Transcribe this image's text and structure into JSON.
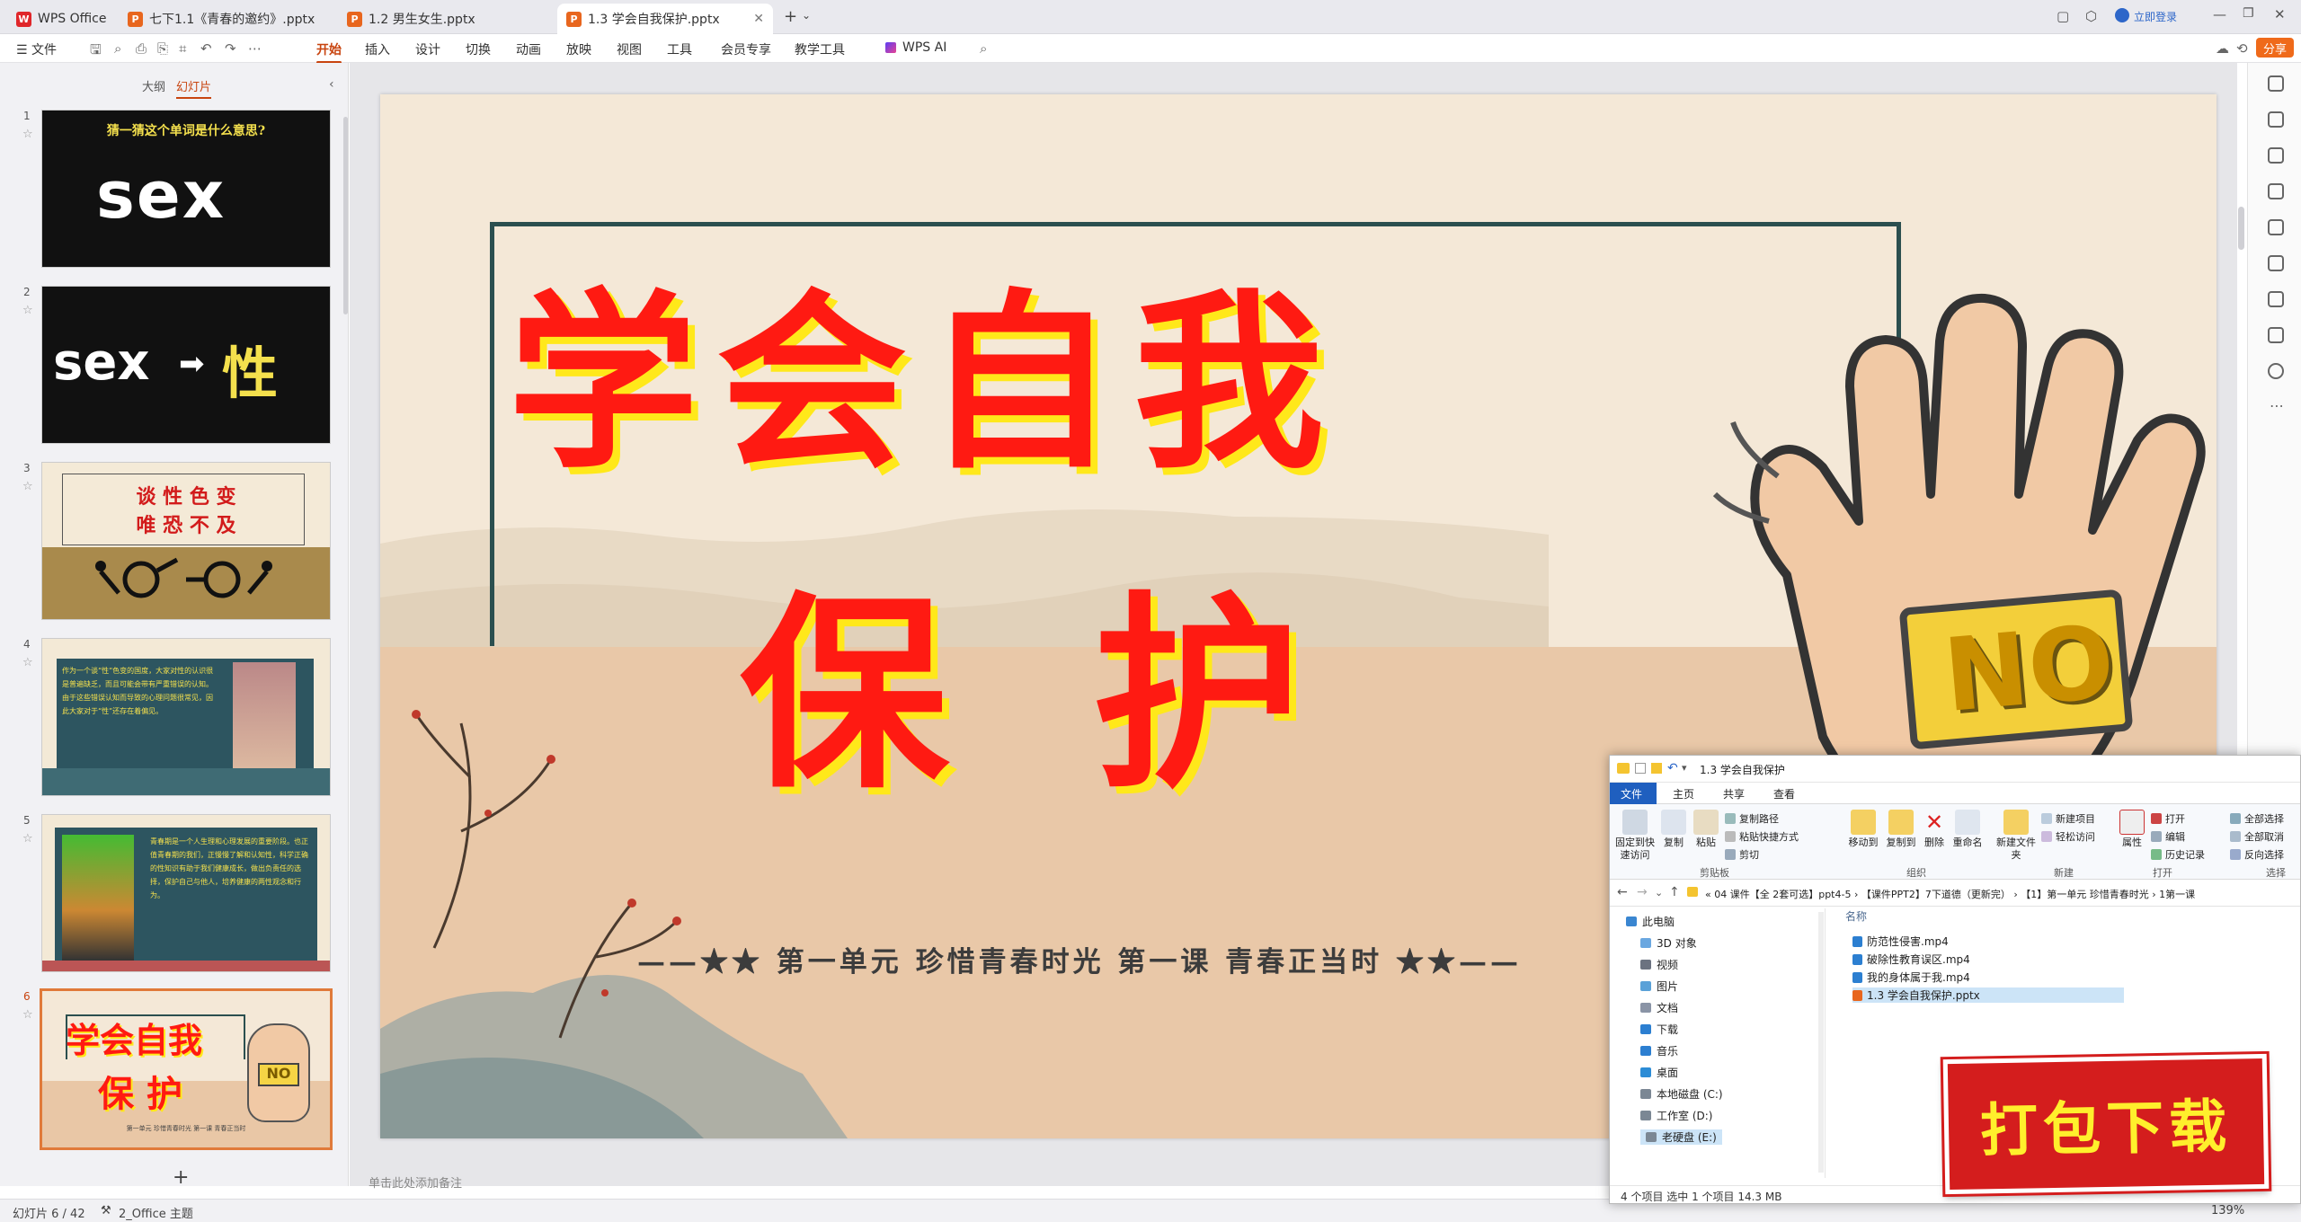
{
  "tabs": [
    {
      "label": "WPS Office",
      "icon": "wps-logo-icon"
    },
    {
      "label": "七下1.1《青春的邀约》.pptx",
      "icon": "ppt-icon"
    },
    {
      "label": "1.2 男生女生.pptx",
      "icon": "ppt-icon"
    },
    {
      "label": "1.3 学会自我保护.pptx",
      "icon": "ppt-icon"
    }
  ],
  "titlebar": {
    "login": "立即登录"
  },
  "menu": {
    "file": "☰ 文件",
    "items": [
      "开始",
      "插入",
      "设计",
      "切换",
      "动画",
      "放映",
      "视图",
      "工具",
      "会员专享",
      "教学工具"
    ],
    "ai": "WPS AI",
    "share": "分享"
  },
  "leftpanel": {
    "outline_tab": "大纲",
    "slides_tab": "幻灯片",
    "add": "+",
    "slides": [
      {
        "num": "1",
        "question": "猜一猜这个单词是什么意思?",
        "word": "sex"
      },
      {
        "num": "2",
        "word": "sex",
        "arrow": "➡",
        "meaning": "性"
      },
      {
        "num": "3",
        "line1": "谈 性 色 变",
        "line2": "唯 恐 不 及"
      },
      {
        "num": "4",
        "text": "作为一个谈“性”色变的国度，大家对性的认识很是普遍缺乏，而且可能会带有严重错误的认知。由于这些错误认知而导致的心理问题很常见，因此大家对于“性”还存在着偏见。"
      },
      {
        "num": "5",
        "text": "青春期是一个人生理和心理发展的重要阶段。也正值青春期的我们，正慢慢了解和认知性，科学正确的性知识有助于我们健康成长，做出负责任的选择，保护自己与他人，培养健康的两性观念和行为。"
      },
      {
        "num": "6",
        "line1": "学会自我",
        "line2": "保 护",
        "no": "NO",
        "footer": "第一单元 珍惜青春时光 第一课 青春正当时"
      }
    ]
  },
  "slide": {
    "title_line1": "学会自我",
    "title_line2": "保 护",
    "stop_sign": "NO",
    "subtitle": "——★★ 第一单元 珍惜青春时光 第一课 青春正当时 ★★——"
  },
  "notes_placeholder": "单击此处添加备注",
  "statusbar": {
    "slide_count": "幻灯片 6 / 42",
    "theme": "2_Office 主题",
    "zoom": "139%"
  },
  "explorer": {
    "title": "1.3 学会自我保护",
    "tabs": [
      "文件",
      "主页",
      "共享",
      "查看"
    ],
    "ribbon": {
      "pin": "固定到快速访问",
      "copy": "复制",
      "paste": "粘贴",
      "copy_path": "复制路径",
      "paste_shortcut": "粘贴快捷方式",
      "cut": "剪切",
      "group_clipboard": "剪贴板",
      "move_to": "移动到",
      "copy_to": "复制到",
      "delete": "删除",
      "rename": "重命名",
      "group_organize": "组织",
      "new_folder": "新建文件夹",
      "new_item": "新建项目",
      "easy_access": "轻松访问",
      "group_new": "新建",
      "properties": "属性",
      "open": "打开",
      "edit": "编辑",
      "history": "历史记录",
      "group_open": "打开",
      "select_all": "全部选择",
      "select_none": "全部取消",
      "invert": "反向选择",
      "group_select": "选择"
    },
    "address": "«  04 课件【全 2套可选】ppt4-5  ›  【课件PPT2】7下道德（更新完）  ›  【1】第一单元  珍惜青春时光  ›  1第一课",
    "nav": [
      "此电脑",
      "3D 对象",
      "视频",
      "图片",
      "文档",
      "下载",
      "音乐",
      "桌面",
      "本地磁盘 (C:)",
      "工作室 (D:)",
      "老硬盘 (E:)"
    ],
    "column_name": "名称",
    "files": [
      "防范性侵害.mp4",
      "破除性教育误区.mp4",
      "我的身体属于我.mp4",
      "1.3 学会自我保护.pptx"
    ],
    "status": "4 个项目    选中 1 个项目  14.3 MB"
  },
  "download_badge": "打包下载",
  "colors": {
    "accent": "#c8440f",
    "title_red": "#ff1a12",
    "title_outline": "#ffe81a",
    "slide_bg": "#f4e8d7",
    "badge_red": "#d41d1d",
    "badge_text": "#ffef2c"
  }
}
